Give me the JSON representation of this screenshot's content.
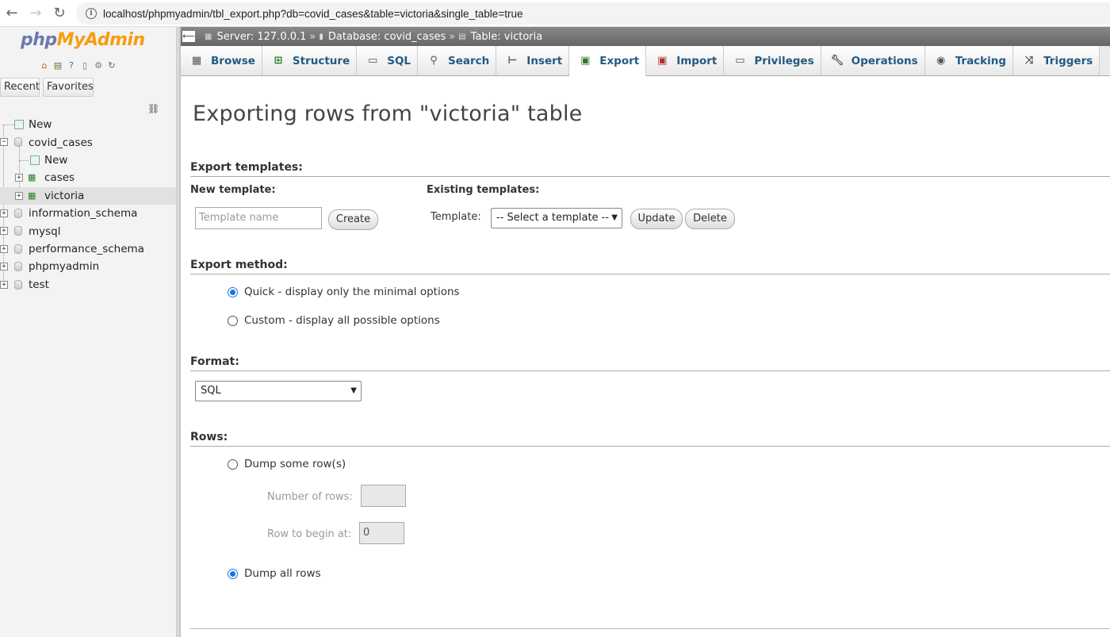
{
  "browser": {
    "url": "localhost/phpmyadmin/tbl_export.php?db=covid_cases&table=victoria&single_table=true"
  },
  "sidebar": {
    "logo": {
      "php": "php",
      "my": "My",
      "admin": "Admin"
    },
    "tabs": {
      "recent": "Recent",
      "favorites": "Favorites"
    },
    "tree": [
      {
        "label": "New"
      },
      {
        "label": "covid_cases"
      },
      {
        "label": "New"
      },
      {
        "label": "cases"
      },
      {
        "label": "victoria"
      },
      {
        "label": "information_schema"
      },
      {
        "label": "mysql"
      },
      {
        "label": "performance_schema"
      },
      {
        "label": "phpmyadmin"
      },
      {
        "label": "test"
      }
    ]
  },
  "breadcrumb": {
    "server": "Server: 127.0.0.1",
    "sep": "»",
    "database": "Database: covid_cases",
    "table": "Table: victoria"
  },
  "tabs": [
    {
      "label": "Browse",
      "icon": "browse-icon"
    },
    {
      "label": "Structure",
      "icon": "structure-icon"
    },
    {
      "label": "SQL",
      "icon": "sql-icon"
    },
    {
      "label": "Search",
      "icon": "search-icon"
    },
    {
      "label": "Insert",
      "icon": "insert-icon"
    },
    {
      "label": "Export",
      "icon": "export-icon",
      "active": true
    },
    {
      "label": "Import",
      "icon": "import-icon"
    },
    {
      "label": "Privileges",
      "icon": "privileges-icon"
    },
    {
      "label": "Operations",
      "icon": "operations-icon"
    },
    {
      "label": "Tracking",
      "icon": "tracking-icon"
    },
    {
      "label": "Triggers",
      "icon": "triggers-icon"
    }
  ],
  "main": {
    "title": "Exporting rows from \"victoria\" table",
    "templates": {
      "heading": "Export templates:",
      "new_heading": "New template:",
      "name_placeholder": "Template name",
      "create": "Create",
      "existing_heading": "Existing templates:",
      "template_label": "Template:",
      "select_value": "-- Select a template --",
      "update": "Update",
      "delete": "Delete"
    },
    "method": {
      "heading": "Export method:",
      "quick": "Quick - display only the minimal options",
      "custom": "Custom - display all possible options",
      "selected": "quick"
    },
    "format": {
      "heading": "Format:",
      "value": "SQL"
    },
    "rows": {
      "heading": "Rows:",
      "dump_some": "Dump some row(s)",
      "number_label": "Number of rows:",
      "number_value": "",
      "begin_label": "Row to begin at:",
      "begin_value": "0",
      "dump_all": "Dump all rows",
      "selected": "all"
    }
  },
  "colors": {
    "link": "#235a81",
    "accent_radio": "#1a73e8",
    "crumb_bg": "#777777"
  }
}
